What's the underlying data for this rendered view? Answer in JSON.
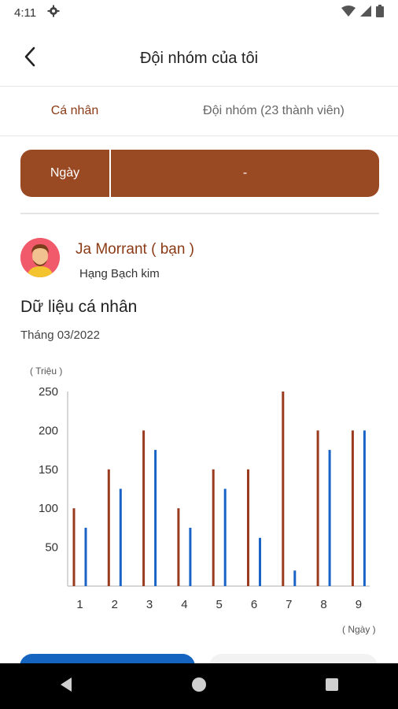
{
  "status_bar": {
    "time": "4:11",
    "icons": [
      "gear-icon",
      "wifi-icon",
      "signal-icon",
      "battery-icon"
    ]
  },
  "header": {
    "title": "Đội nhóm của tôi",
    "back_icon": "chevron-left-icon"
  },
  "tabs": [
    {
      "label": "Cá nhân",
      "active": true
    },
    {
      "label": "Đội nhóm (23 thành viên)",
      "active": false
    }
  ],
  "period": {
    "label": "Ngày",
    "value": "-"
  },
  "profile": {
    "name": "Ja Morrant ( bạn )",
    "rank": "Hạng Bạch kim"
  },
  "section": {
    "title": "Dữ liệu cá nhân",
    "subtitle": "Tháng 03/2022"
  },
  "chart_data": {
    "type": "bar",
    "y_unit_label": "( Triệu )",
    "x_unit_label": "( Ngày )",
    "categories": [
      "1",
      "2",
      "3",
      "4",
      "5",
      "6",
      "7",
      "8",
      "9"
    ],
    "y_ticks": [
      50,
      100,
      150,
      200,
      250
    ],
    "ylim": [
      0,
      250
    ],
    "grid": false,
    "series": [
      {
        "values": [
          100,
          150,
          200,
          100,
          150,
          150,
          250,
          200,
          200
        ],
        "color": "#9a3a1e"
      },
      {
        "values": [
          75,
          125,
          175,
          75,
          125,
          62,
          20,
          175,
          200
        ],
        "color": "#1a63c6"
      }
    ]
  },
  "colors": {
    "accent": "#9a4a23",
    "tab_active": "#8b3a16",
    "primary_button": "#1565c0"
  },
  "nav": {
    "buttons": [
      "back-triangle-icon",
      "home-circle-icon",
      "recents-square-icon"
    ]
  }
}
